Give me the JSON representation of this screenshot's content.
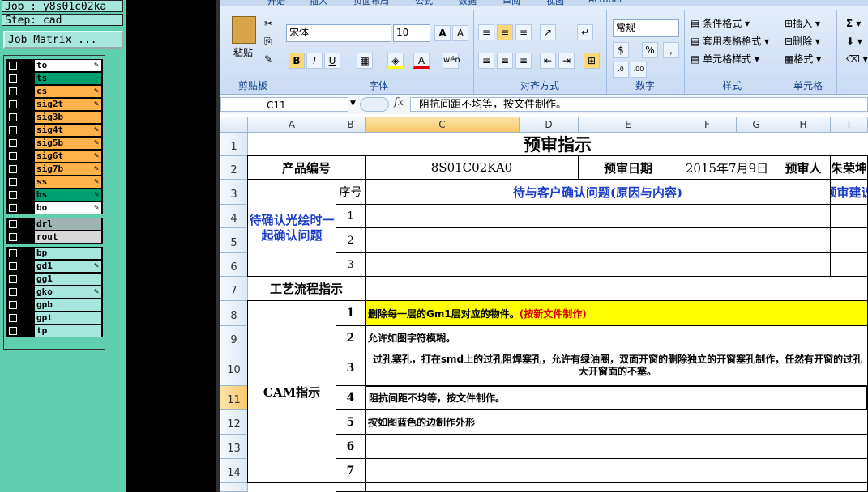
{
  "cad": {
    "job_label": "Job : y8s01c02ka",
    "step_label": "Step: cad",
    "matrix_button": "Job Matrix ...",
    "layer_groups": [
      [
        {
          "name": "to",
          "color": "#ffffff",
          "mark": "✎"
        },
        {
          "name": "ts",
          "color": "#00a070",
          "mark": ""
        },
        {
          "name": "cs",
          "color": "#ffb24a",
          "mark": "✎"
        },
        {
          "name": "sig2t",
          "color": "#ffb24a",
          "mark": "✎"
        },
        {
          "name": "sig3b",
          "color": "#ffb24a",
          "mark": ""
        },
        {
          "name": "sig4t",
          "color": "#ffb24a",
          "mark": "✎"
        },
        {
          "name": "sig5b",
          "color": "#ffb24a",
          "mark": "✎"
        },
        {
          "name": "sig6t",
          "color": "#ffb24a",
          "mark": "✎"
        },
        {
          "name": "sig7b",
          "color": "#ffb24a",
          "mark": "✎"
        },
        {
          "name": "ss",
          "color": "#ffb24a",
          "mark": "✎"
        },
        {
          "name": "bs",
          "color": "#00a070",
          "mark": "✎"
        },
        {
          "name": "bo",
          "color": "#ffffff",
          "mark": "✎"
        }
      ],
      [
        {
          "name": "drl",
          "color": "#9fb3b3",
          "mark": ""
        },
        {
          "name": "rout",
          "color": "#d8d8d8",
          "mark": ""
        }
      ],
      [
        {
          "name": "bp",
          "color": "#a7e6dc",
          "mark": ""
        },
        {
          "name": "gd1",
          "color": "#a7e6dc",
          "mark": "✎"
        },
        {
          "name": "gg1",
          "color": "#a7e6dc",
          "mark": ""
        },
        {
          "name": "gko",
          "color": "#a7e6dc",
          "mark": "✎"
        },
        {
          "name": "gpb",
          "color": "#a7e6dc",
          "mark": ""
        },
        {
          "name": "gpt",
          "color": "#a7e6dc",
          "mark": ""
        },
        {
          "name": "tp",
          "color": "#a7e6dc",
          "mark": ""
        }
      ]
    ]
  },
  "ribbon": {
    "tabs": [
      "开始",
      "插入",
      "页面布局",
      "公式",
      "数据",
      "审阅",
      "视图",
      "Acrobat"
    ],
    "paste_label": "粘贴",
    "font_name": "宋体",
    "font_size": "10",
    "number_format": "常规",
    "styles": [
      "条件格式",
      "套用表格格式",
      "单元格样式"
    ],
    "cells": [
      "插入",
      "删除",
      "格式"
    ],
    "group_labels": [
      "剪贴板",
      "字体",
      "对齐方式",
      "数字",
      "样式",
      "单元格"
    ]
  },
  "formula_bar": {
    "name_box": "C11",
    "fx": "fx",
    "content": "阻抗间距不均等，按文件制作。"
  },
  "sheet": {
    "columns": [
      "A",
      "B",
      "C",
      "D",
      "E",
      "F",
      "G",
      "H",
      "I"
    ],
    "rows": [
      "1",
      "2",
      "3",
      "4",
      "5",
      "6",
      "7",
      "8",
      "9",
      "10",
      "11",
      "12",
      "13",
      "14",
      ""
    ],
    "title": "预审指示",
    "product_no_label": "产品编号",
    "product_no": "8S01C02KA0",
    "date_label": "预审日期",
    "date": "2015年7月9日",
    "reviewer_label": "预审人",
    "reviewer": "朱荣坤",
    "confirm_section": "待确认光绘时一起确认问题",
    "seq_label": "序号",
    "issues_header": "待与客户确认问题(原因与内容)",
    "advice_header": "预审建议",
    "confirm_nums": [
      "1",
      "2",
      "3"
    ],
    "process_label": "工艺流程指示",
    "cam_label": "CAM指示",
    "cam_items": [
      {
        "n": "1",
        "text": "删除每一层的Gm1层对应的物件。",
        "note": "(按新文件制作)"
      },
      {
        "n": "2",
        "text": "允许如图字符模糊。",
        "note": ""
      },
      {
        "n": "3",
        "text": "过孔塞孔，打在smd上的过孔阻焊塞孔，允许有绿油圈，双面开窗的删除独立的开窗塞孔制作，任然有开窗的过孔 大开窗面的不塞。",
        "note": ""
      },
      {
        "n": "4",
        "text": "阻抗间距不均等，按文件制作。",
        "note": ""
      },
      {
        "n": "5",
        "text": "按如图蓝色的边制作外形",
        "note": ""
      },
      {
        "n": "6",
        "text": "",
        "note": ""
      },
      {
        "n": "7",
        "text": "",
        "note": ""
      }
    ],
    "highlight_color": "#ffff00",
    "note_color": "#e00000"
  }
}
